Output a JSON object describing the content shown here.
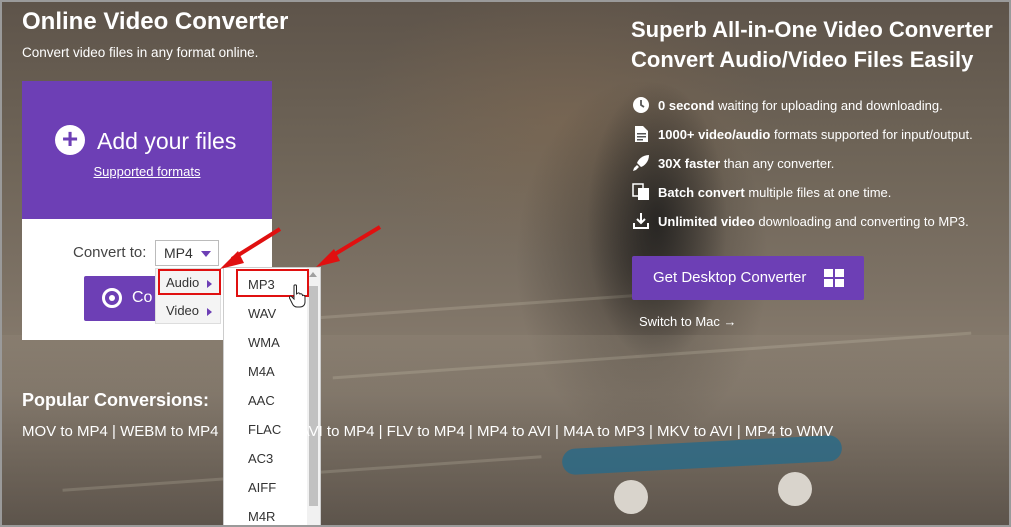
{
  "left": {
    "title": "Online Video Converter",
    "subtitle": "Convert video files in any format online."
  },
  "upload": {
    "add_label": "Add your files",
    "supported_link": "Supported formats",
    "convert_to_label": "Convert to:",
    "selected_format": "MP4",
    "convert_button": "Co"
  },
  "submenu": {
    "items": [
      {
        "label": "Audio"
      },
      {
        "label": "Video"
      }
    ]
  },
  "format_list": [
    "MP3",
    "WAV",
    "WMA",
    "M4A",
    "AAC",
    "FLAC",
    "AC3",
    "AIFF",
    "M4R"
  ],
  "popular": {
    "title": "Popular Conversions:",
    "left_links": "MOV to MP4 | WEBM to MP4",
    "right_links": "| AVI to MP4 | FLV to MP4 | MP4 to AVI | M4A to MP3 | MKV to AVI | MP4 to WMV"
  },
  "right": {
    "headline_1": "Superb All-in-One Video Converter",
    "headline_2": "Convert Audio/Video Files Easily",
    "features": [
      {
        "icon": "clock-icon",
        "bold": "0 second",
        "rest": " waiting for uploading and downloading."
      },
      {
        "icon": "file-icon",
        "bold": "1000+ video/audio",
        "rest": " formats supported for input/output."
      },
      {
        "icon": "rocket-icon",
        "bold": "30X faster",
        "rest": " than any converter."
      },
      {
        "icon": "batch-icon",
        "bold": "Batch convert",
        "rest": " multiple files at one time."
      },
      {
        "icon": "download-icon",
        "bold": "Unlimited video",
        "rest": " downloading and converting to MP3."
      }
    ],
    "desktop_button": "Get Desktop Converter",
    "switch_mac": "Switch to Mac →"
  },
  "colors": {
    "purple": "#6d3fb5",
    "highlight_red": "#e01010"
  }
}
